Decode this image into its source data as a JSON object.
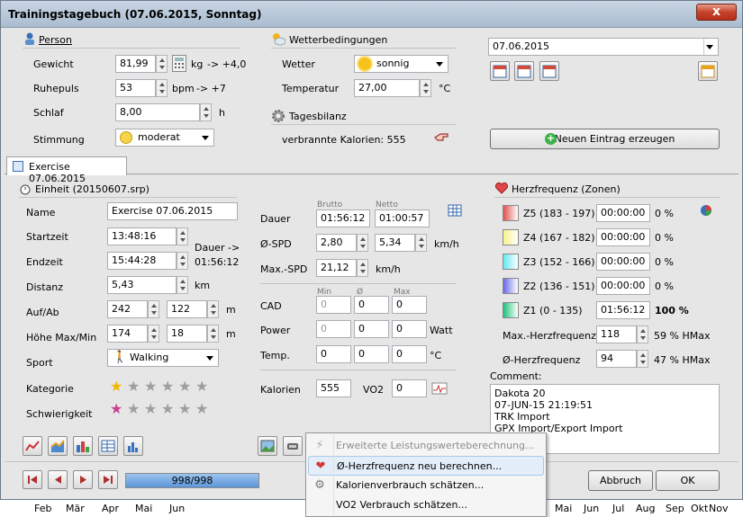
{
  "window": {
    "title": "Trainingstagebuch (07.06.2015, Sonntag)",
    "close_label": "x"
  },
  "person": {
    "header": "Person",
    "gewicht_label": "Gewicht",
    "gewicht": "81,99",
    "gewicht_unit": "kg",
    "gewicht_delta": "-> +4,0",
    "ruhepuls_label": "Ruhepuls",
    "ruhepuls": "53",
    "ruhepuls_unit": "bpm",
    "ruhepuls_delta": "-> +7",
    "schlaf_label": "Schlaf",
    "schlaf": "8,00",
    "schlaf_unit": "h",
    "stimmung_label": "Stimmung",
    "stimmung": "moderat"
  },
  "wetter": {
    "header": "Wetterbedingungen",
    "wetter_label": "Wetter",
    "wetter": "sonnig",
    "temp_label": "Temperatur",
    "temp": "27,00",
    "temp_unit": "°C"
  },
  "bilanz": {
    "header": "Tagesbilanz",
    "kalorien_text": "verbrannte Kalorien: 555"
  },
  "date": {
    "value": "07.06.2015"
  },
  "new_entry_label": "Neuen Eintrag erzeugen",
  "tab": {
    "label": "Exercise 07.06.2015"
  },
  "einheit": {
    "header": "Einheit (20150607.srp)",
    "name_label": "Name",
    "name": "Exercise 07.06.2015",
    "start_label": "Startzeit",
    "start": "13:48:16",
    "end_label": "Endzeit",
    "end": "15:44:28",
    "dauer_arrow": "Dauer ->",
    "dauer_value": "01:56:12",
    "distanz_label": "Distanz",
    "distanz": "5,43",
    "distanz_unit": "km",
    "aufab_label": "Auf/Ab",
    "auf": "242",
    "ab": "122",
    "aufab_unit": "m",
    "hoehe_label": "Höhe Max/Min",
    "hoehe_max": "174",
    "hoehe_min": "18",
    "hoehe_unit": "m",
    "sport_label": "Sport",
    "sport": "Walking",
    "kategorie_label": "Kategorie",
    "schwierigkeit_label": "Schwierigkeit"
  },
  "stars": {
    "kategorie": 1,
    "schwierigkeit": 1,
    "total": 6,
    "kategorie_color": "#f2b600",
    "schwierigkeit_color": "#c8408e"
  },
  "metrics": {
    "brutto_label": "Brutto",
    "netto_label": "Netto",
    "dauer_label": "Dauer",
    "dauer_brutto": "01:56:12",
    "dauer_netto": "01:00:57",
    "spd_label": "Ø-SPD",
    "spd_brutto": "2,80",
    "spd_netto": "5,34",
    "spd_unit": "km/h",
    "maxspd_label": "Max.-SPD",
    "maxspd": "21,12",
    "maxspd_unit": "km/h",
    "min_label": "Min",
    "avg_label": "Ø",
    "max_label": "Max",
    "cad_label": "CAD",
    "cad_min": "0",
    "cad_avg": "0",
    "cad_max": "0",
    "power_label": "Power",
    "power_min": "0",
    "power_avg": "0",
    "power_max": "0",
    "power_unit": "Watt",
    "temp_label": "Temp.",
    "temp_min": "0",
    "temp_avg": "0",
    "temp_max": "0",
    "temp_unit": "°C",
    "kalorien_label": "Kalorien",
    "kalorien": "555",
    "vo2_label": "VO2",
    "vo2": "0"
  },
  "hr": {
    "header": "Herzfrequenz (Zonen)",
    "zones": [
      {
        "label": "Z5 (183 - 197)",
        "time": "00:00:00",
        "pct": "0 %",
        "color": "#e05050"
      },
      {
        "label": "Z4 (167 - 182)",
        "time": "00:00:00",
        "pct": "0 %",
        "color": "#f7f28a"
      },
      {
        "label": "Z3 (152 - 166)",
        "time": "00:00:00",
        "pct": "0 %",
        "color": "#66e8f0"
      },
      {
        "label": "Z2 (136 - 151)",
        "time": "00:00:00",
        "pct": "0 %",
        "color": "#6a6ae8"
      },
      {
        "label": "Z1 (0 - 135)",
        "time": "01:56:12",
        "pct": "100 %",
        "color": "#22c07a"
      }
    ],
    "max_label": "Max.-Herzfrequenz",
    "max": "118",
    "max_pct": "59 % HMax",
    "avg_label": "Ø-Herzfrequenz",
    "avg": "94",
    "avg_pct": "47 % HMax"
  },
  "comment": {
    "label": "Comment:",
    "text": "Dakota 20\n07-JUN-15 21:19:51\nTRK Import\nGPX Import/Export Import"
  },
  "nav": {
    "progress": "998/998",
    "progress_fraction": 0.997
  },
  "buttons": {
    "abbruch": "Abbruch",
    "ok": "OK"
  },
  "menu": {
    "items": [
      {
        "label": "Erweiterte Leistungswerteberechnung...",
        "disabled": true,
        "icon": "lightning-icon"
      },
      {
        "label": "Ø-Herzfrequenz neu berechnen...",
        "highlighted": true,
        "icon": "heart-icon"
      },
      {
        "label": "Kalorienverbrauch schätzen...",
        "icon": "gear-icon"
      },
      {
        "label": "VO2 Verbrauch schätzen...",
        "icon": "none"
      }
    ]
  },
  "taskbar": {
    "months_left": [
      "Feb",
      "Mär",
      "Apr",
      "Mai",
      "Jun"
    ],
    "months_right": [
      "Mai",
      "Jun",
      "Jul",
      "Aug",
      "Sep",
      "Okt",
      "Nov"
    ]
  }
}
